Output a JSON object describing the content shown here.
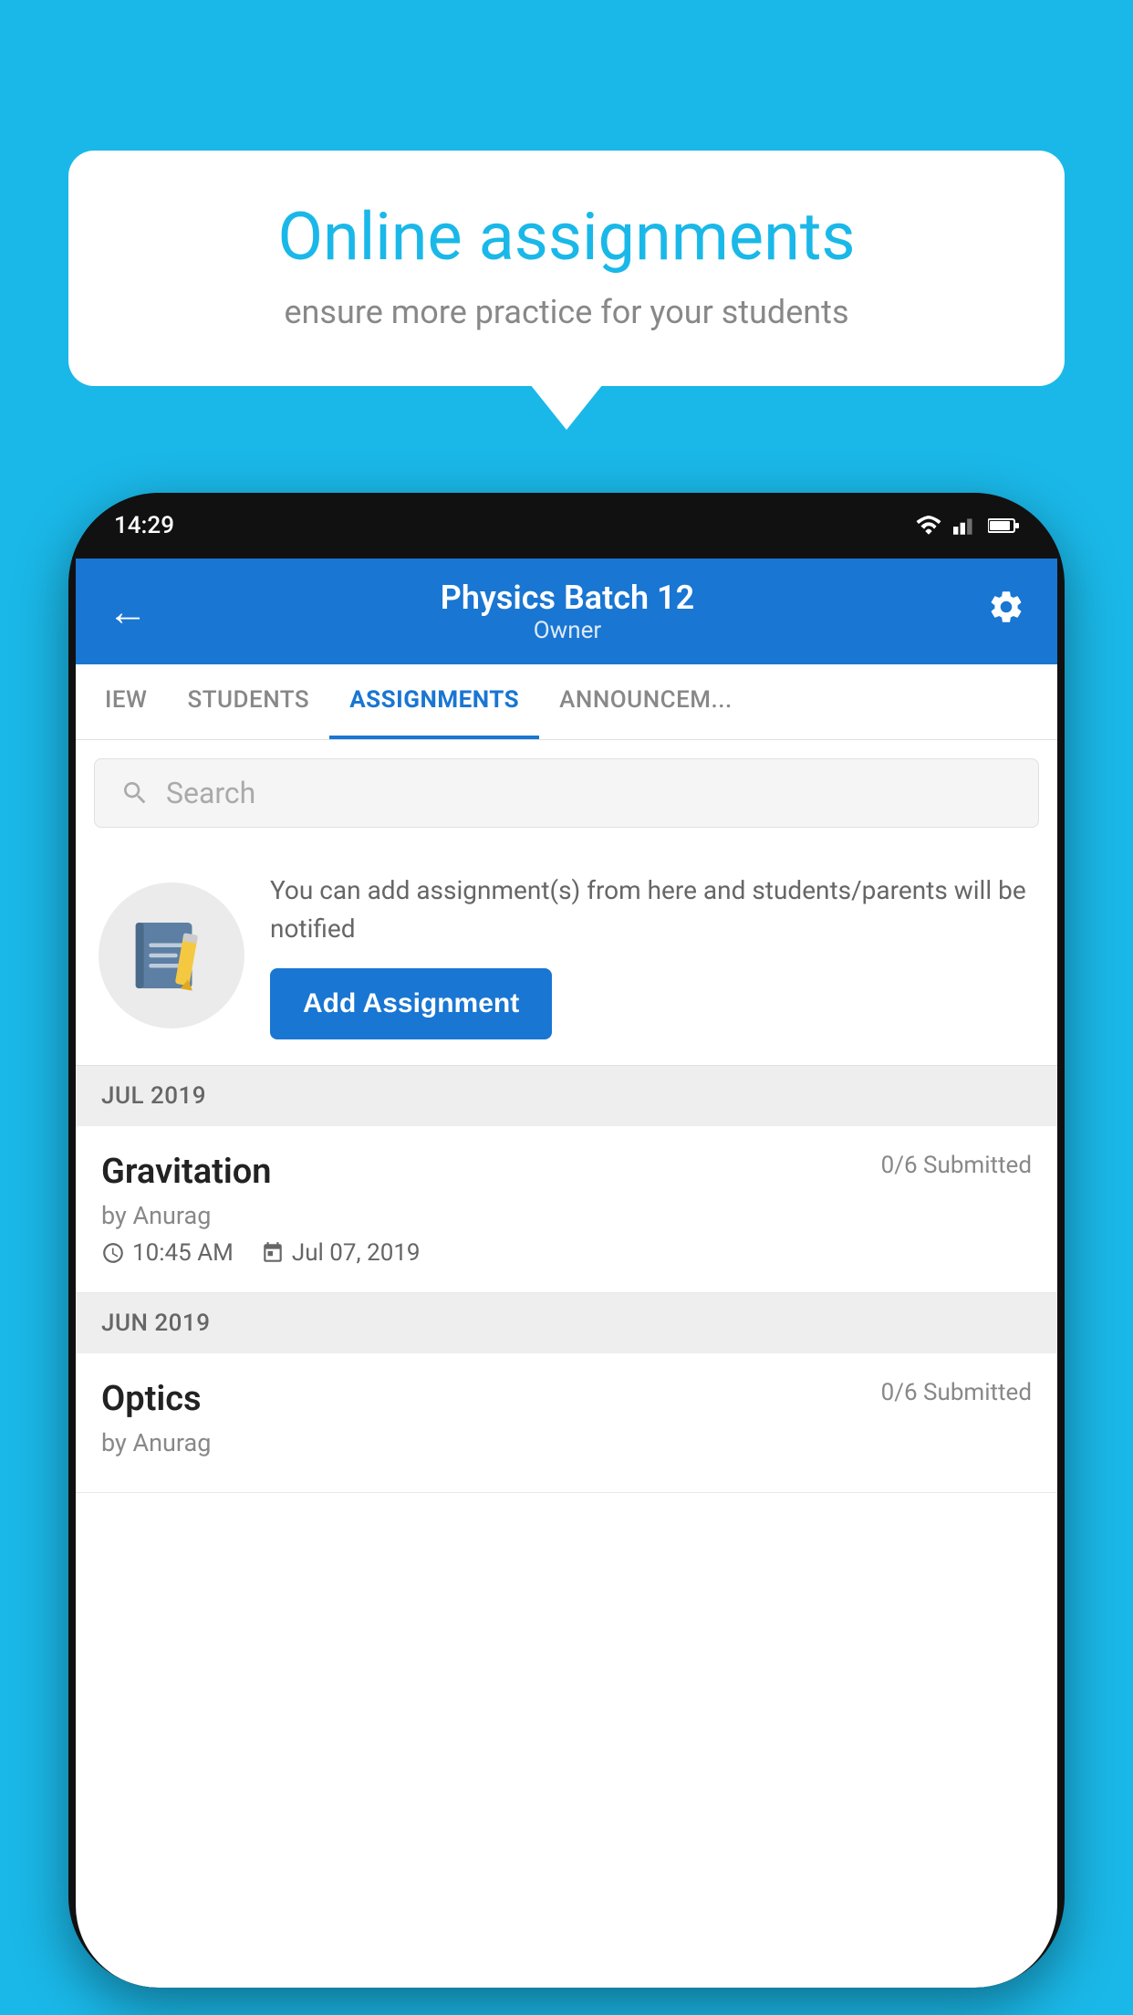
{
  "background_color": "#1ab8e8",
  "speech_bubble": {
    "title": "Online assignments",
    "subtitle": "ensure more practice for your students"
  },
  "phone": {
    "status_bar": {
      "time": "14:29"
    },
    "header": {
      "title": "Physics Batch 12",
      "subtitle": "Owner"
    },
    "tabs": [
      {
        "label": "IEW",
        "active": false
      },
      {
        "label": "STUDENTS",
        "active": false
      },
      {
        "label": "ASSIGNMENTS",
        "active": true
      },
      {
        "label": "ANNOUNCEM...",
        "active": false
      }
    ],
    "search": {
      "placeholder": "Search"
    },
    "promo": {
      "description": "You can add assignment(s) from here and students/parents will be notified",
      "button_label": "Add Assignment"
    },
    "sections": [
      {
        "month": "JUL 2019",
        "assignments": [
          {
            "title": "Gravitation",
            "submitted": "0/6 Submitted",
            "author": "by Anurag",
            "time": "10:45 AM",
            "date": "Jul 07, 2019"
          }
        ]
      },
      {
        "month": "JUN 2019",
        "assignments": [
          {
            "title": "Optics",
            "submitted": "0/6 Submitted",
            "author": "by Anurag",
            "time": "",
            "date": ""
          }
        ]
      }
    ]
  }
}
